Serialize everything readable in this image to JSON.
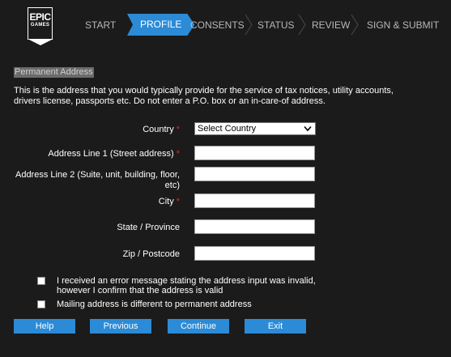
{
  "logo": {
    "line1": "EPIC",
    "line2": "GAMES"
  },
  "steps": [
    "START",
    "PROFILE",
    "CONSENTS",
    "STATUS",
    "REVIEW",
    "SIGN & SUBMIT"
  ],
  "active_step": "PROFILE",
  "section": {
    "title": "Permanent Address",
    "intro": "This is the address that you would typically provide for the service of tax notices, utility accounts, drivers license, passports etc. Do not enter a P.O. box or an in-care-of address."
  },
  "form": {
    "required_marker": "*",
    "country_label": "Country",
    "country_value": "Select Country",
    "address1_label": "Address Line 1 (Street address)",
    "address2_label_line1": "Address Line 2 (Suite, unit, building, floor,",
    "address2_label_line2": "etc)",
    "city_label": "City",
    "state_label": "State / Province",
    "zip_label": "Zip /  Postcode"
  },
  "checkboxes": {
    "invalid_line1": "I received an error message stating the address input was invalid,",
    "invalid_line2": "however I confirm that the address is valid",
    "mailing": "Mailing address is different to permanent address"
  },
  "buttons": {
    "help": "Help",
    "previous": "Previous",
    "continue": "Continue",
    "exit": "Exit"
  },
  "colors": {
    "accent": "#2b8bd7",
    "background": "#1b1b1b",
    "required": "#e0262b"
  }
}
